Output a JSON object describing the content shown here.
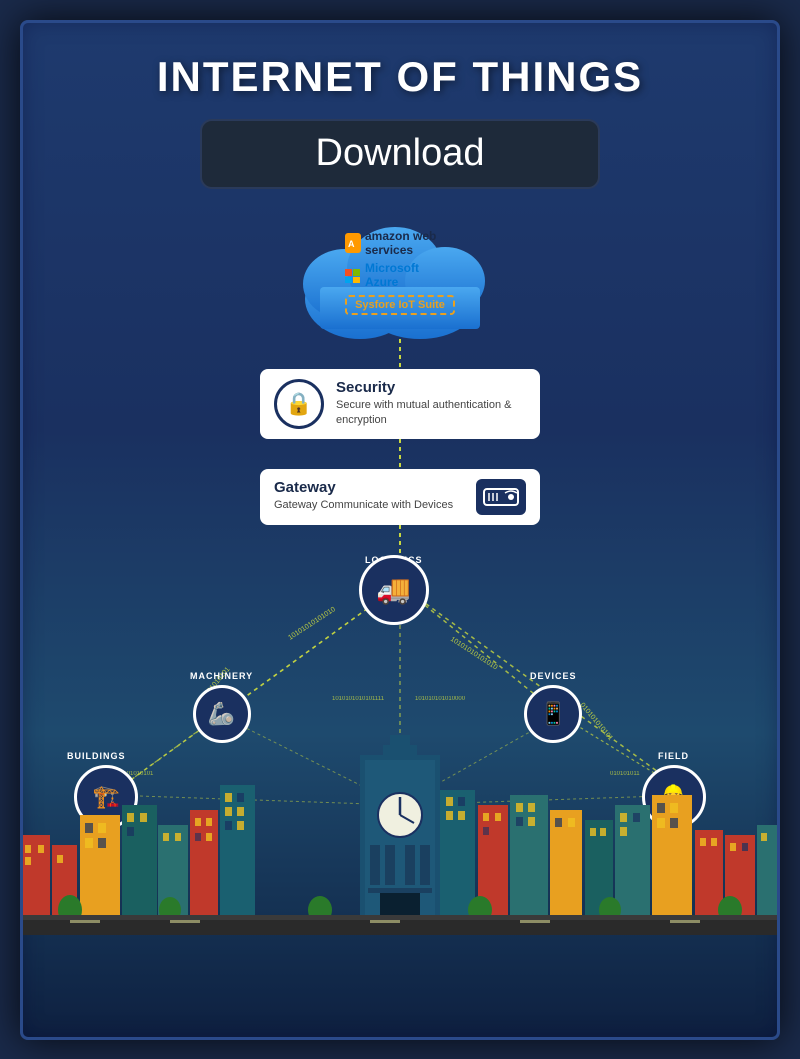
{
  "title": "INTERNET OF THINGS",
  "download_button": "Download",
  "cloud": {
    "aws_label": "amazon\nweb services",
    "azure_label": "Microsoft Azure",
    "sysfore_label": "Sysfore IoT Suite"
  },
  "security_card": {
    "title": "Security",
    "description": "Secure with mutual authentication & encryption",
    "icon": "🔒"
  },
  "gateway_card": {
    "title": "Gateway",
    "description": "Gateway Communicate with Devices",
    "icon": "📡"
  },
  "nodes": [
    {
      "label": "LOGISTICS",
      "icon": "🚚",
      "size": "center"
    },
    {
      "label": "MACHINERY",
      "icon": "🦾",
      "size": "mid"
    },
    {
      "label": "DEVICES",
      "icon": "📱",
      "size": "mid"
    },
    {
      "label": "BUILDINGS",
      "icon": "🏗️",
      "size": "outer"
    },
    {
      "label": "FIELD",
      "icon": "👷",
      "size": "outer"
    }
  ],
  "colors": {
    "background": "#1a2a4a",
    "card_border": "#1a3060",
    "binary_line": "#c8d840",
    "cloud_blue": "#2080e0",
    "download_bg": "#1e2a3a"
  }
}
